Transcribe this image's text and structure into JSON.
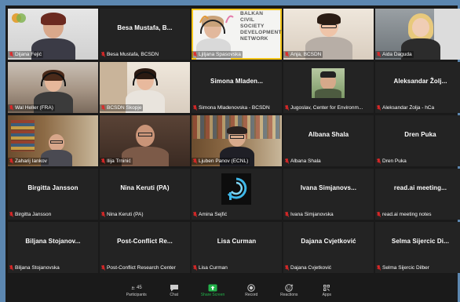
{
  "app": "Zoom meeting gallery view",
  "logo_text": [
    "BALKAN",
    "CIVIL",
    "SOCIETY",
    "DEVELOPMENT",
    "NETWORK"
  ],
  "tiles": [
    {
      "name": "Dijana Fejić",
      "center": "",
      "muted": true,
      "video": true
    },
    {
      "name": "Besa Mustafa, BCSDN",
      "center": "Besa Mustafa, B...",
      "muted": true,
      "video": false
    },
    {
      "name": "Ljiljana Spasovska",
      "center": "",
      "muted": true,
      "video": true,
      "active": true
    },
    {
      "name": "Anja, BCSDN",
      "center": "",
      "muted": true,
      "video": true
    },
    {
      "name": "Aida Daguda",
      "center": "",
      "muted": true,
      "video": true
    },
    {
      "name": "Wal Heller (FRA)",
      "center": "",
      "muted": true,
      "video": true
    },
    {
      "name": "BCSDN Skopje",
      "center": "",
      "muted": true,
      "video": true
    },
    {
      "name": "Simona Mladenovska - BCSDN",
      "center": "Simona Mladen...",
      "muted": true,
      "video": false
    },
    {
      "name": "Jugoslav, Center for Environm...",
      "center": "",
      "muted": true,
      "video": true
    },
    {
      "name": "Aleksandar Žolja - hCa",
      "center": "Aleksandar Žolj...",
      "muted": true,
      "video": false
    },
    {
      "name": "Zaharij Iankov",
      "center": "",
      "muted": true,
      "video": true
    },
    {
      "name": "Ilija Trninić",
      "center": "",
      "muted": true,
      "video": true
    },
    {
      "name": "Ljuben Panov (ECNL)",
      "center": "",
      "muted": true,
      "video": true
    },
    {
      "name": "Albana Shala",
      "center": "Albana Shala",
      "muted": true,
      "video": false
    },
    {
      "name": "Dren Puka",
      "center": "Dren Puka",
      "muted": true,
      "video": false
    },
    {
      "name": "Birgitta Jansson",
      "center": "Birgitta Jansson",
      "muted": true,
      "video": false
    },
    {
      "name": "Nina Keruti (PA)",
      "center": "Nina Keruti (PA)",
      "muted": true,
      "video": false
    },
    {
      "name": "Amina Sejfić",
      "center": "",
      "muted": true,
      "video": false,
      "avatar": true
    },
    {
      "name": "Ivana Simjanovska",
      "center": "Ivana Simjanovs...",
      "muted": true,
      "video": false
    },
    {
      "name": "read.ai meeting notes",
      "center": "read.ai meeting...",
      "muted": true,
      "video": false
    },
    {
      "name": "Biljana Stojanovska",
      "center": "Biljana Stojanov...",
      "muted": true,
      "video": false
    },
    {
      "name": "Post-Conflict Research Center",
      "center": "Post-Conflict Re...",
      "muted": true,
      "video": false
    },
    {
      "name": "Lisa Curman",
      "center": "Lisa Curman",
      "muted": true,
      "video": false
    },
    {
      "name": "Dajana Cvjetković",
      "center": "Dajana Cvjetković",
      "muted": true,
      "video": false
    },
    {
      "name": "Selma Sijercic Dilber",
      "center": "Selma Sijercic Di...",
      "muted": true,
      "video": false
    }
  ],
  "toolbar": {
    "participants_count": "45",
    "participants_label": "Participants",
    "chat_label": "Chat",
    "share_label": "Share Screen",
    "record_label": "Record",
    "reactions_label": "Reactions",
    "apps_label": "Apps"
  },
  "colors": {
    "muted_icon": "#e02828",
    "share_green": "#23b24a",
    "active_outline": "#f5c518"
  }
}
